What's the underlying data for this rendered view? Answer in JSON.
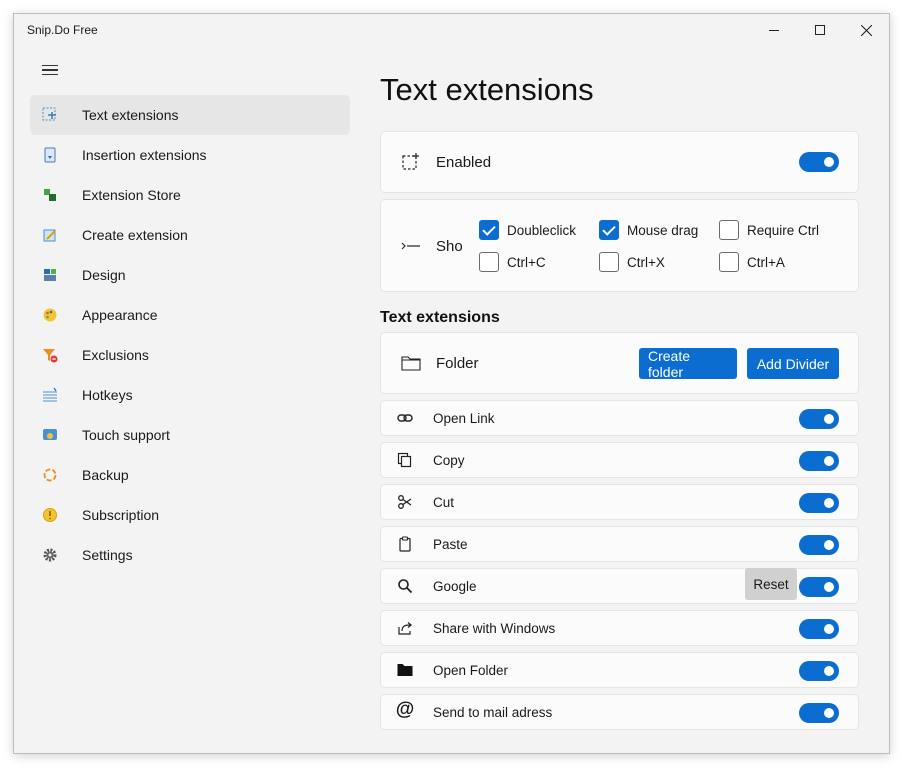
{
  "window": {
    "title": "Snip.Do Free",
    "controls": {
      "minimize": "—",
      "maximize": "☐",
      "close": "✕"
    }
  },
  "sidebar": {
    "items": [
      {
        "label": "Text extensions",
        "icon": "text-extensions-icon",
        "active": true
      },
      {
        "label": "Insertion extensions",
        "icon": "insertion-extensions-icon"
      },
      {
        "label": "Extension Store",
        "icon": "extension-store-icon"
      },
      {
        "label": "Create extension",
        "icon": "create-extension-icon"
      },
      {
        "label": "Design",
        "icon": "design-icon"
      },
      {
        "label": "Appearance",
        "icon": "appearance-icon"
      },
      {
        "label": "Exclusions",
        "icon": "exclusions-icon"
      },
      {
        "label": "Hotkeys",
        "icon": "hotkeys-icon"
      },
      {
        "label": "Touch support",
        "icon": "touch-support-icon"
      },
      {
        "label": "Backup",
        "icon": "backup-icon"
      },
      {
        "label": "Subscription",
        "icon": "subscription-icon"
      },
      {
        "label": "Settings",
        "icon": "gear-icon"
      }
    ]
  },
  "main": {
    "title": "Text extensions",
    "enabled": {
      "label": "Enabled",
      "on": true
    },
    "show": {
      "label": "Sho",
      "options": [
        {
          "label": "Doubleclick",
          "checked": true
        },
        {
          "label": "Mouse drag",
          "checked": true
        },
        {
          "label": "Require Ctrl",
          "checked": false
        },
        {
          "label": "Ctrl+C",
          "checked": false
        },
        {
          "label": "Ctrl+X",
          "checked": false
        },
        {
          "label": "Ctrl+A",
          "checked": false
        }
      ]
    },
    "section_title": "Text extensions",
    "folder": {
      "label": "Folder",
      "create_folder": "Create folder",
      "add_divider": "Add Divider"
    },
    "extensions": [
      {
        "label": "Open Link",
        "icon": "link-icon",
        "on": true
      },
      {
        "label": "Copy",
        "icon": "copy-icon",
        "on": true
      },
      {
        "label": "Cut",
        "icon": "scissors-icon",
        "on": true
      },
      {
        "label": "Paste",
        "icon": "clipboard-icon",
        "on": true
      },
      {
        "label": "Google",
        "icon": "search-icon",
        "on": true,
        "reset": "Reset"
      },
      {
        "label": "Share with Windows",
        "icon": "share-icon",
        "on": true
      },
      {
        "label": "Open Folder",
        "icon": "folder-icon",
        "on": true
      },
      {
        "label": "Send to mail adress",
        "icon": "at-icon",
        "on": true
      }
    ]
  },
  "colors": {
    "accent": "#0a6dcf",
    "window_bg": "#f3f3f3",
    "card_bg": "#fbfbfb",
    "active_nav": "#e6e6e6"
  }
}
